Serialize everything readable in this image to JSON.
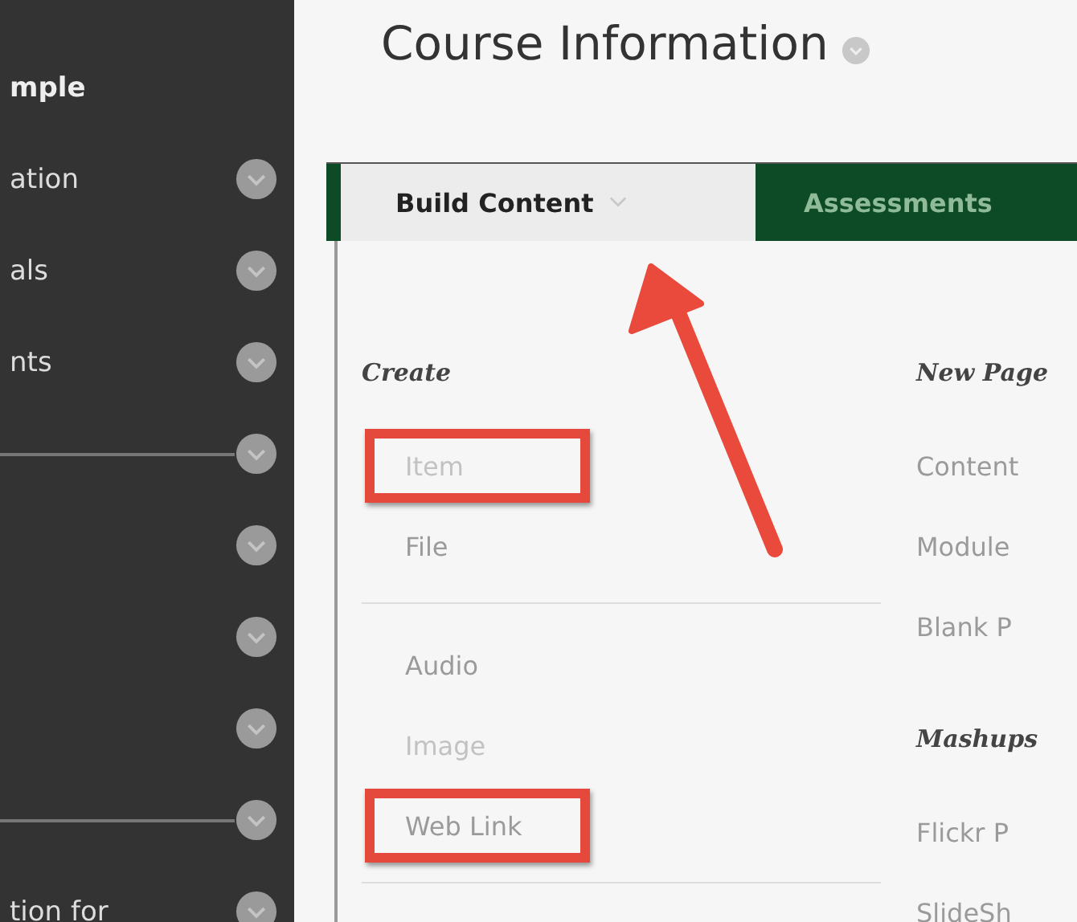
{
  "sidebar": {
    "items": [
      {
        "kind": "header",
        "label": "mple"
      },
      {
        "kind": "link",
        "label": "ation"
      },
      {
        "kind": "link",
        "label": "als"
      },
      {
        "kind": "link",
        "label": "nts"
      },
      {
        "kind": "separator"
      },
      {
        "kind": "link"
      },
      {
        "kind": "link"
      },
      {
        "kind": "link"
      },
      {
        "kind": "separator"
      },
      {
        "kind": "link",
        "label": "tion for"
      }
    ]
  },
  "page": {
    "title": "Course Information"
  },
  "menu_bar": {
    "tabs": [
      {
        "label": "Build Content",
        "selected": true
      },
      {
        "label": "Assessments",
        "selected": false
      }
    ]
  },
  "dropdown": {
    "columns": [
      {
        "sections": [
          {
            "heading": "Create",
            "items": [
              {
                "label": "Item",
                "disabled": true,
                "highlighted": true
              },
              {
                "label": "File",
                "disabled": false,
                "highlighted": false
              }
            ]
          },
          {
            "items": [
              {
                "label": "Audio",
                "disabled": false,
                "highlighted": false
              },
              {
                "label": "Image",
                "disabled": true,
                "highlighted": false
              },
              {
                "label": "Web Link",
                "disabled": false,
                "highlighted": true
              }
            ]
          }
        ]
      },
      {
        "sections": [
          {
            "heading": "New Page",
            "items": [
              {
                "label": "Content",
                "disabled": false,
                "highlighted": false
              },
              {
                "label": "Module",
                "disabled": false,
                "highlighted": false
              },
              {
                "label": "Blank P",
                "disabled": false,
                "highlighted": false
              }
            ]
          },
          {
            "heading": "Mashups",
            "items": [
              {
                "label": "Flickr P",
                "disabled": false,
                "highlighted": false
              },
              {
                "label": "SlideSh",
                "disabled": false,
                "highlighted": false
              }
            ]
          }
        ]
      }
    ]
  }
}
